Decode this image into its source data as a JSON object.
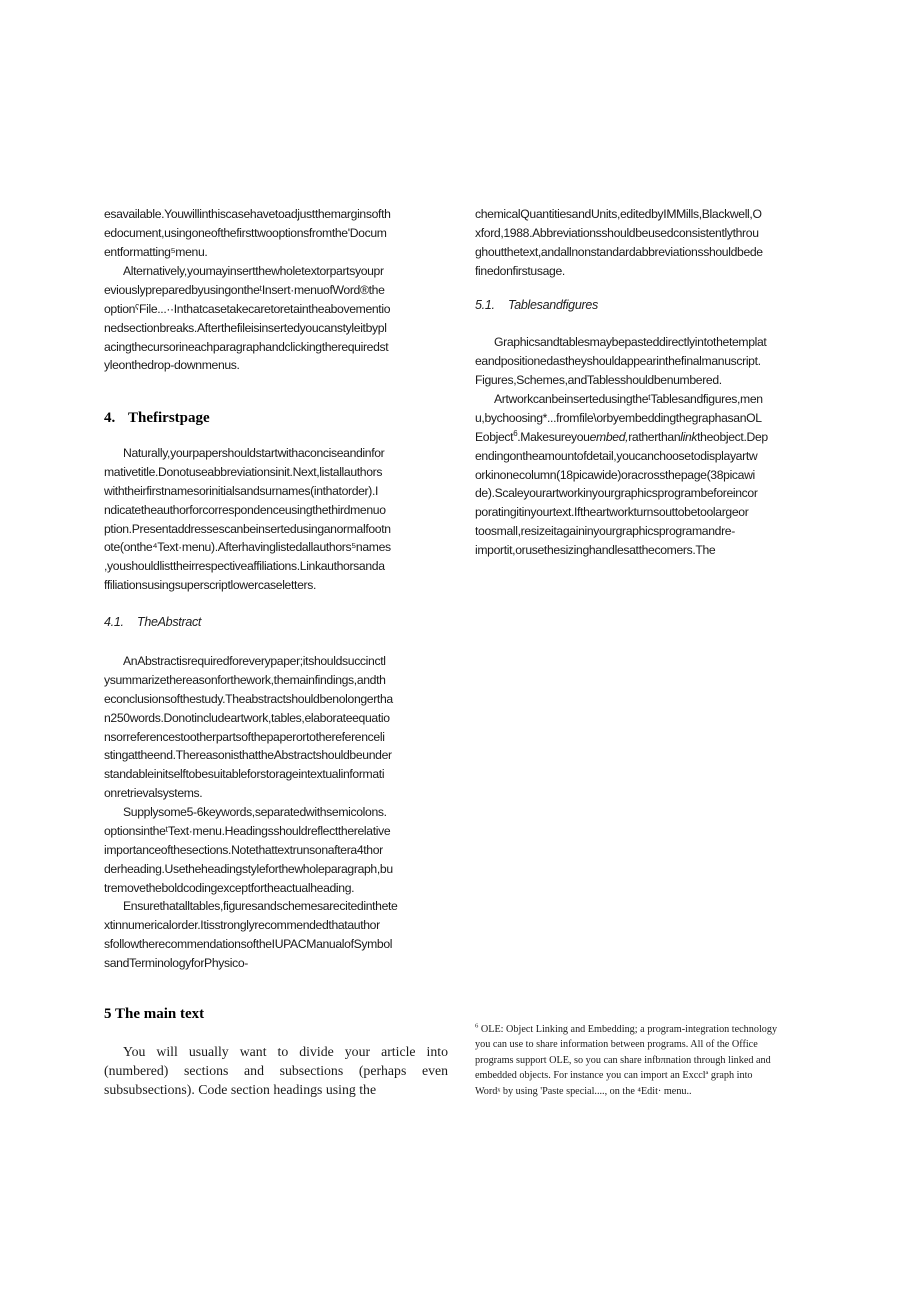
{
  "left_column": {
    "intro_lines": [
      "esavailable.Youwillinthiscasehavetoadjustthemarginsofth",
      "edocument,usingoneofthefirsttwooptionsfromthe'Docum",
      "entformatting⁵menu."
    ],
    "alternatively_lines": [
      "Alternatively,youmayinsertthewholetextorpartsyoupr",
      "eviouslypreparedbyusingontheᵗInsert·menuofWord®the",
      "optionˤFile...··Inthatcasetakecaretoretaintheabovementio",
      "nedsectionbreaks.Afterthefileisinsertedyoucanstyleitbypl",
      "acingthecursorineachparagraphandclickingtherequiredst",
      "yleonthedrop-downmenus."
    ],
    "section4": {
      "number": "4.",
      "title": "Thefirstpage",
      "lines": [
        "Naturally,yourpapershouldstartwithaconciseandinfor",
        "mativetitle.Donotuseabbreviationsinit.Next,listallauthors",
        "withtheirfirstnamesorinitialsandsurnames(inthatorder).I",
        "ndicatetheauthorforcorrespondenceusingthethirdmenuo",
        "ption.Presentaddressescanbeinsertedusinganormalfootn",
        "ote(onthe⁴Text·menu).Afterhavinglistedallauthors⁵names",
        ",youshouldlisttheirrespectiveaffiliations.Linkauthorsanda",
        "ffiliationsusingsuperscriptlowercaseletters."
      ]
    },
    "section41": {
      "number": "4.1.",
      "title": "TheAbstract",
      "abstract_lines": [
        "AnAbstractisrequiredforeverypaper;itshouldsuccinctl",
        "ysummarizethereasonforthework,themainfindings,andth",
        "econclusionsofthestudy.Theabstractshouldbenolongertha",
        "n250words.Donotincludeartwork,tables,elaborateequatio",
        "nsorreferencestootherpartsofthepaperortothereferenceli",
        "stingattheend.ThereasonisthattheAbstractshouldbeunder",
        "standableinitselftobesuitableforstorageintextualinformati",
        "onretrievalsystems."
      ],
      "keywords_lines": [
        "Supplysome5-6keywords,separatedwithsemicolons.",
        "optionsintheᵗText·menu.Headingsshouldreflecttherelative",
        "importanceofthesections.Notethattextrunsonaftera4thor",
        "derheading.Usetheheadingstyleforthewholeparagraph,bu",
        "tremovetheboldcodingexceptfortheactualheading."
      ],
      "ensure_lines": [
        "Ensurethatalltables,figuresandschemesarecitedinthete",
        "xtinnumericalorder.Itisstronglyrecommendedthatauthor",
        "sfollowtherecommendationsoftheIUPACManualofSymbol",
        "sandTerminologyforPhysico-"
      ]
    },
    "section5": {
      "title": "5 The main text",
      "paragraph": "You will usually want to divide your article into (numbered) sections and subsections (perhaps even subsubsections). Code section headings using the"
    }
  },
  "right_column": {
    "continued_lines": [
      "chemicalQuantitiesandUnits,editedbyIMMills,Blackwell,O",
      "xford,1988.Abbreviationsshouldbeusedconsistentlythrou",
      "ghoutthetext,andallnonstandardabbreviationsshouldbede",
      "finedonfirstusage."
    ],
    "section51": {
      "number": "5.1.",
      "title": "Tablesandfigures",
      "graphics_lines": [
        "Graphicsandtablesmaybepasteddirectlyintothetemplat",
        "eandpositionedastheyshouldappearinthefinalmanuscript.",
        "Figures,Schemes,andTablesshouldbenumbered."
      ],
      "artwork_lines": {
        "l1": "ArtworkcanbeinsertedusingtheᵗTablesandfigures,men",
        "l2": "u,bychoosing*...fromfile\\orbyembeddingthegraphasanOL",
        "l3_pre": "Eobject",
        "l3_sup": "6",
        "l3_a": ".Makesureyou",
        "l3_em1": "embed,",
        "l3_b": "ratherthan",
        "l3_em2": "link",
        "l3_c": "theobject.Dep",
        "rest": [
          "endingontheamountofdetail,youcanchoosetodisplayartw",
          "orkinonecolumn(18picawide)oracrossthepage(38picawi",
          "de).Scaleyourartworkinyourgraphicsprogrambeforeincor",
          "poratingitinyourtext.Iftheartworkturnsouttobetoolargeor",
          "toosmall,resizeitagaininyourgraphicsprogramandre-",
          "importit,orusethesizinghandlesatthecomers.The"
        ]
      }
    },
    "footnote": {
      "marker": "6",
      "lines": [
        " OLE: Object Linking and Embedding; a program-integration technology",
        "you can use to share information between programs. All of the Office",
        "programs support OLE, so you can share infbπnation through linked and",
        "embedded objects. For instance you can import an Excclª graph into",
        "Wordˣ by using 'Paste special...., on the ⁴Edit· menu.."
      ]
    }
  }
}
